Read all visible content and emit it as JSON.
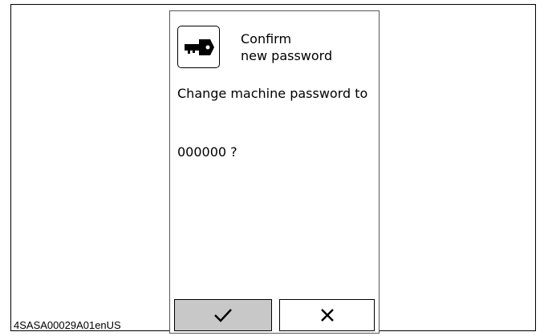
{
  "dialog": {
    "title_line1": "Confirm",
    "title_line2": "new password",
    "message": "Change machine password to",
    "new_password": "000000 ?",
    "icon": "key-icon"
  },
  "buttons": {
    "confirm": {
      "icon": "checkmark-icon",
      "state": "highlighted"
    },
    "cancel": {
      "icon": "close-icon"
    }
  },
  "footer": {
    "document_code": "4SASA00029A01enUS"
  }
}
